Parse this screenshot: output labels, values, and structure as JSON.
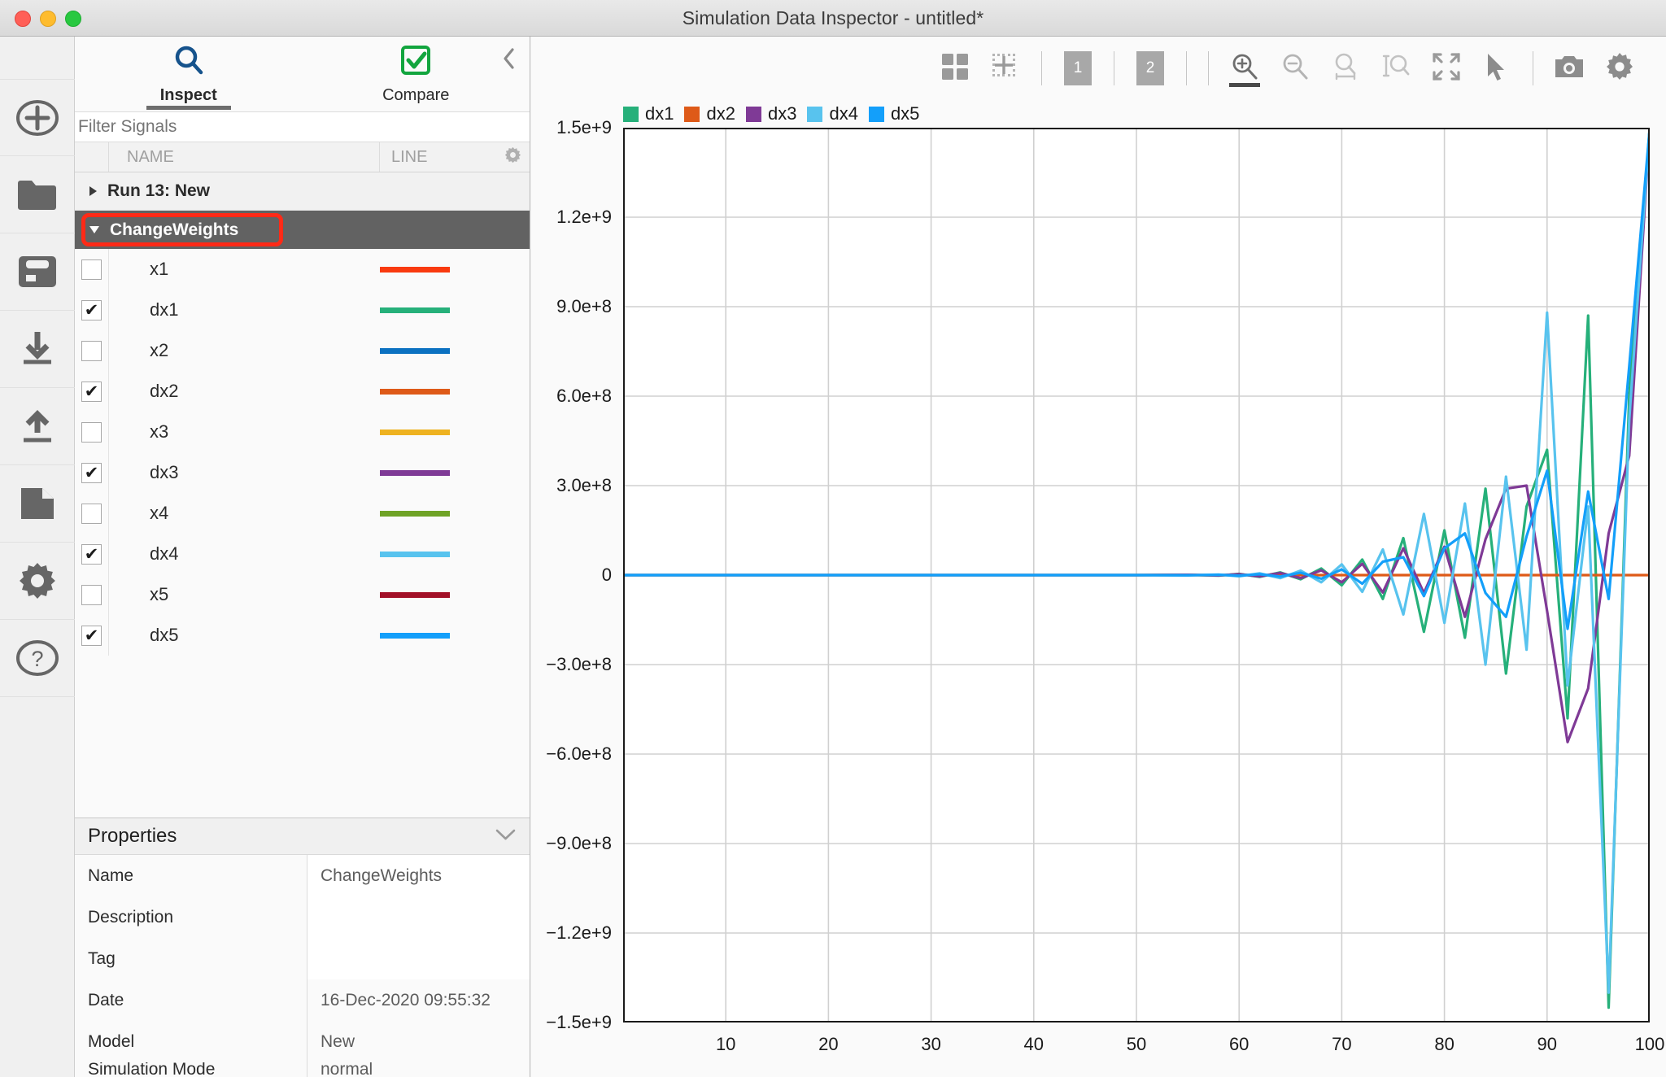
{
  "window": {
    "title": "Simulation Data Inspector - untitled*",
    "traffic_lights": [
      "close",
      "minimize",
      "maximize"
    ]
  },
  "rail": {
    "items": [
      {
        "name": "new-run",
        "icon": "plus-circle-icon"
      },
      {
        "name": "open",
        "icon": "folder-icon"
      },
      {
        "name": "save",
        "icon": "floppy-disk-icon"
      },
      {
        "name": "import",
        "icon": "download-icon"
      },
      {
        "name": "export",
        "icon": "upload-icon"
      },
      {
        "name": "report",
        "icon": "document-icon"
      },
      {
        "name": "settings",
        "icon": "gear-icon"
      },
      {
        "name": "help",
        "icon": "question-circle-icon"
      }
    ]
  },
  "left_panel": {
    "tabs": [
      {
        "label": "Inspect",
        "icon": "magnifier-icon",
        "active": true
      },
      {
        "label": "Compare",
        "icon": "check-square-icon",
        "active": false
      }
    ],
    "collapse_icon": "chevron-left-icon",
    "filter": {
      "placeholder": "Filter Signals",
      "value": ""
    },
    "columns": {
      "name": "NAME",
      "line": "LINE",
      "gear_icon": "gear-icon"
    },
    "run": {
      "label": "Run 13: New",
      "expanded": false
    },
    "group": {
      "label": "ChangeWeights",
      "expanded": true,
      "selected": true,
      "highlight_color": "#ff2a17"
    },
    "signals": [
      {
        "name": "x1",
        "checked": false,
        "color": "#f93a0f"
      },
      {
        "name": "dx1",
        "checked": true,
        "color": "#26b07a"
      },
      {
        "name": "x2",
        "checked": false,
        "color": "#0b71c1"
      },
      {
        "name": "dx2",
        "checked": true,
        "color": "#de5a18"
      },
      {
        "name": "x3",
        "checked": false,
        "color": "#eeb220"
      },
      {
        "name": "dx3",
        "checked": true,
        "color": "#7f3a96"
      },
      {
        "name": "x4",
        "checked": false,
        "color": "#6fa326"
      },
      {
        "name": "dx4",
        "checked": true,
        "color": "#58c3ee"
      },
      {
        "name": "x5",
        "checked": false,
        "color": "#a31028"
      },
      {
        "name": "dx5",
        "checked": true,
        "color": "#139ffa"
      }
    ],
    "checkmark": "✔"
  },
  "properties": {
    "title": "Properties",
    "collapse_icon": "chevron-down-icon",
    "rows": [
      {
        "key": "Name",
        "value": "ChangeWeights",
        "shade": "white"
      },
      {
        "key": "Description",
        "value": "",
        "shade": "white"
      },
      {
        "key": "Tag",
        "value": "",
        "shade": "white"
      },
      {
        "key": "Date",
        "value": "16-Dec-2020 09:55:32",
        "shade": "grey"
      },
      {
        "key": "Model",
        "value": "New",
        "shade": "grey"
      },
      {
        "key": "Simulation Mode",
        "value": "normal",
        "shade": "grey"
      }
    ]
  },
  "toolbar": {
    "buttons": [
      {
        "name": "layout-grid-button",
        "icon": "grid-2x2-icon",
        "active": false
      },
      {
        "name": "sparse-grid-button",
        "icon": "dotted-grid-icon",
        "active": false
      },
      {
        "name": "axis-1-button",
        "icon": "number-1-icon",
        "label": "1",
        "active": false
      },
      {
        "name": "axis-2-button",
        "icon": "number-2-icon",
        "label": "2",
        "active": false
      },
      {
        "name": "zoom-in-button",
        "icon": "zoom-in-icon",
        "active": true
      },
      {
        "name": "zoom-out-button",
        "icon": "zoom-out-icon",
        "active": false
      },
      {
        "name": "zoom-x-button",
        "icon": "zoom-horizontal-icon",
        "active": false
      },
      {
        "name": "zoom-y-button",
        "icon": "zoom-vertical-icon",
        "active": false
      },
      {
        "name": "fit-to-view-button",
        "icon": "expand-arrows-icon",
        "active": false
      },
      {
        "name": "pointer-button",
        "icon": "cursor-arrow-icon",
        "active": false
      },
      {
        "name": "snapshot-button",
        "icon": "camera-icon",
        "active": false
      },
      {
        "name": "plot-settings-button",
        "icon": "gear-icon",
        "active": false
      }
    ]
  },
  "chart_data": {
    "type": "line",
    "title": "",
    "xlabel": "",
    "ylabel": "",
    "xlim": [
      0,
      100
    ],
    "ylim": [
      -1500000000,
      1500000000
    ],
    "grid": true,
    "legend_position": "top-left",
    "x_ticks": [
      10,
      20,
      30,
      40,
      50,
      60,
      70,
      80,
      90,
      100
    ],
    "x_tick_labels": [
      "10",
      "20",
      "30",
      "40",
      "50",
      "60",
      "70",
      "80",
      "90",
      "100"
    ],
    "y_ticks": [
      1500000000,
      1200000000,
      900000000,
      600000000,
      300000000,
      0,
      -300000000,
      -600000000,
      -900000000,
      -1200000000,
      -1500000000
    ],
    "y_tick_labels": [
      "1.5e+9",
      "1.2e+9",
      "9.0e+8",
      "6.0e+8",
      "3.0e+8",
      "0",
      "−3.0e+8",
      "−6.0e+8",
      "−9.0e+8",
      "−1.2e+9",
      "−1.5e+9"
    ],
    "legend": [
      "dx1",
      "dx2",
      "dx3",
      "dx4",
      "dx5"
    ],
    "series": [
      {
        "name": "dx1",
        "color": "#26b07a",
        "x": [
          0,
          5,
          10,
          15,
          20,
          25,
          30,
          35,
          40,
          45,
          50,
          55,
          58,
          60,
          62,
          64,
          66,
          68,
          70,
          72,
          74,
          76,
          78,
          80,
          82,
          84,
          86,
          88,
          90,
          92,
          94,
          96,
          98,
          100
        ],
        "y": [
          0,
          0,
          0,
          0,
          0,
          0,
          0,
          0,
          0,
          0,
          0,
          1000000,
          -2000000,
          4000000,
          -6000000,
          9000000,
          -14000000,
          22000000,
          -34000000,
          52000000,
          -80000000,
          124000000,
          -190000000,
          150000000,
          -210000000,
          290000000,
          -330000000,
          230000000,
          420000000,
          -480000000,
          870000000,
          -1450000000,
          600000000,
          1500000000
        ]
      },
      {
        "name": "dx2",
        "color": "#de5a18",
        "x": [
          0,
          10,
          20,
          30,
          40,
          50,
          60,
          70,
          80,
          90,
          100
        ],
        "y": [
          0,
          0,
          0,
          0,
          0,
          0,
          0,
          0,
          0,
          0,
          0
        ]
      },
      {
        "name": "dx3",
        "color": "#7f3a96",
        "x": [
          0,
          5,
          10,
          15,
          20,
          25,
          30,
          35,
          40,
          45,
          50,
          55,
          58,
          60,
          62,
          64,
          66,
          68,
          70,
          72,
          74,
          76,
          78,
          80,
          82,
          84,
          86,
          88,
          90,
          92,
          94,
          96,
          98,
          100
        ],
        "y": [
          0,
          0,
          0,
          0,
          0,
          0,
          0,
          0,
          0,
          0,
          0,
          1000000,
          -1000000,
          3000000,
          -4000000,
          7000000,
          -10000000,
          16000000,
          -24000000,
          38000000,
          -58000000,
          90000000,
          -60000000,
          95000000,
          -140000000,
          120000000,
          290000000,
          300000000,
          -120000000,
          -560000000,
          -380000000,
          140000000,
          400000000,
          1500000000
        ]
      },
      {
        "name": "dx4",
        "color": "#58c3ee",
        "x": [
          0,
          5,
          10,
          15,
          20,
          25,
          30,
          35,
          40,
          45,
          50,
          55,
          58,
          60,
          62,
          64,
          66,
          68,
          70,
          72,
          74,
          76,
          78,
          80,
          82,
          84,
          86,
          88,
          90,
          92,
          94,
          96,
          98,
          100
        ],
        "y": [
          0,
          0,
          0,
          0,
          0,
          0,
          0,
          0,
          0,
          0,
          0,
          -1000000,
          2000000,
          -4000000,
          6000000,
          -10000000,
          15000000,
          -24000000,
          36000000,
          -56000000,
          86000000,
          -132000000,
          205000000,
          -160000000,
          240000000,
          -300000000,
          330000000,
          -250000000,
          880000000,
          -370000000,
          230000000,
          -1400000000,
          520000000,
          1500000000
        ]
      },
      {
        "name": "dx5",
        "color": "#139ffa",
        "x": [
          0,
          5,
          10,
          15,
          20,
          25,
          30,
          35,
          40,
          45,
          50,
          55,
          58,
          60,
          62,
          64,
          66,
          68,
          70,
          72,
          74,
          76,
          78,
          80,
          82,
          84,
          86,
          88,
          90,
          92,
          94,
          96,
          98,
          100
        ],
        "y": [
          0,
          0,
          0,
          0,
          0,
          0,
          0,
          0,
          0,
          0,
          0,
          -500000,
          1000000,
          -2000000,
          3000000,
          -5000000,
          8000000,
          -12000000,
          19000000,
          -29000000,
          45000000,
          60000000,
          -70000000,
          90000000,
          140000000,
          -60000000,
          -140000000,
          130000000,
          350000000,
          -180000000,
          280000000,
          -80000000,
          700000000,
          1500000000
        ]
      }
    ]
  }
}
